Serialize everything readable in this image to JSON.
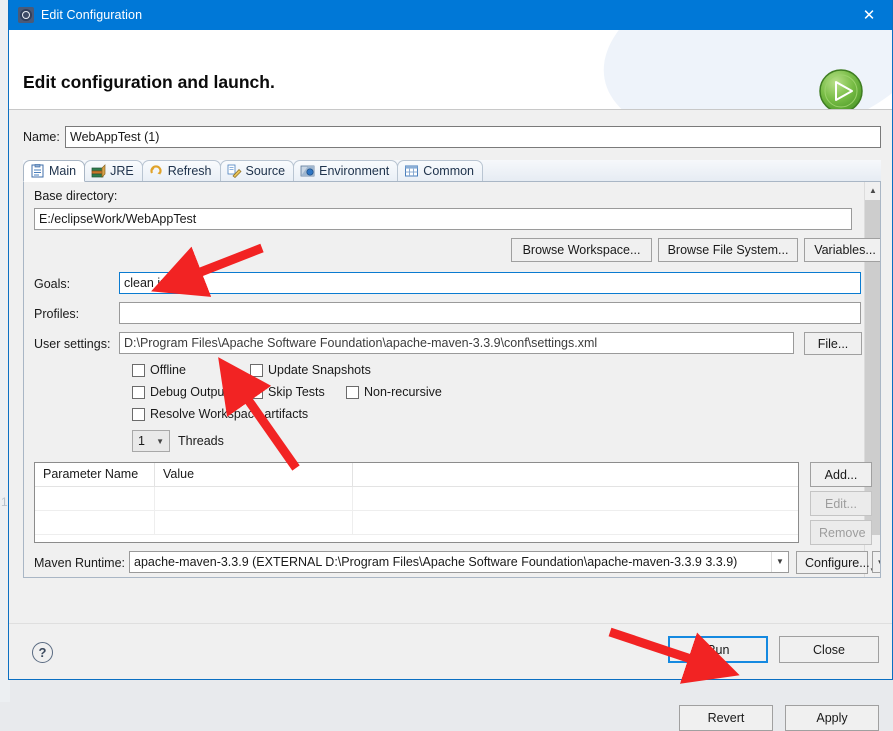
{
  "window": {
    "title": "Edit Configuration",
    "title_icon": "gear-icon",
    "close_icon": "close-icon",
    "titlebar_color": "#0078d7"
  },
  "banner": {
    "heading": "Edit configuration and launch.",
    "badge_icon": "run-play-icon",
    "badge_color": "#6cb33f"
  },
  "name": {
    "label": "Name:",
    "value": "WebAppTest (1)"
  },
  "tabs": [
    {
      "label": "Main",
      "icon": "clipboard-icon",
      "selected": true
    },
    {
      "label": "JRE",
      "icon": "books-icon",
      "selected": false
    },
    {
      "label": "Refresh",
      "icon": "refresh-icon",
      "selected": false
    },
    {
      "label": "Source",
      "icon": "source-pencil-icon",
      "selected": false
    },
    {
      "label": "Environment",
      "icon": "environment-icon",
      "selected": false
    },
    {
      "label": "Common",
      "icon": "common-table-icon",
      "selected": false
    }
  ],
  "main": {
    "base_directory": {
      "label": "Base directory:",
      "value": "E:/eclipseWork/WebAppTest"
    },
    "browse_buttons": [
      {
        "label": "Browse Workspace..."
      },
      {
        "label": "Browse File System..."
      },
      {
        "label": "Variables..."
      }
    ],
    "goals": {
      "label": "Goals:",
      "value": "clean install",
      "focused": true
    },
    "profiles": {
      "label": "Profiles:",
      "value": ""
    },
    "user_settings": {
      "label": "User settings:",
      "value": "D:\\Program Files\\Apache Software Foundation\\apache-maven-3.3.9\\conf\\settings.xml",
      "button": "File..."
    },
    "checkboxes": [
      {
        "label": "Offline",
        "checked": false
      },
      {
        "label": "Update Snapshots",
        "checked": false
      },
      {
        "label": "Debug Output",
        "checked": false
      },
      {
        "label": "Skip Tests",
        "checked": true
      },
      {
        "label": "Non-recursive",
        "checked": false
      },
      {
        "label": "Resolve Workspace artifacts",
        "checked": false
      }
    ],
    "threads": {
      "value": "1",
      "label": "Threads"
    },
    "parameters_table": {
      "columns": [
        "Parameter Name",
        "Value"
      ],
      "rows": [],
      "empty_row_count": 3
    },
    "table_buttons": [
      {
        "label": "Add...",
        "enabled": true
      },
      {
        "label": "Edit...",
        "enabled": false
      },
      {
        "label": "Remove",
        "enabled": false
      }
    ],
    "maven_runtime": {
      "label": "Maven Runtime:",
      "value": "apache-maven-3.3.9 (EXTERNAL D:\\Program Files\\Apache Software Foundation\\apache-maven-3.3.9 3.3.9)",
      "configure_button": "Configure..."
    }
  },
  "footer": {
    "revert": "Revert",
    "apply": "Apply",
    "help_icon": "help-question-icon",
    "run": "Run",
    "close": "Close"
  },
  "background": {
    "edge_number": "1"
  }
}
